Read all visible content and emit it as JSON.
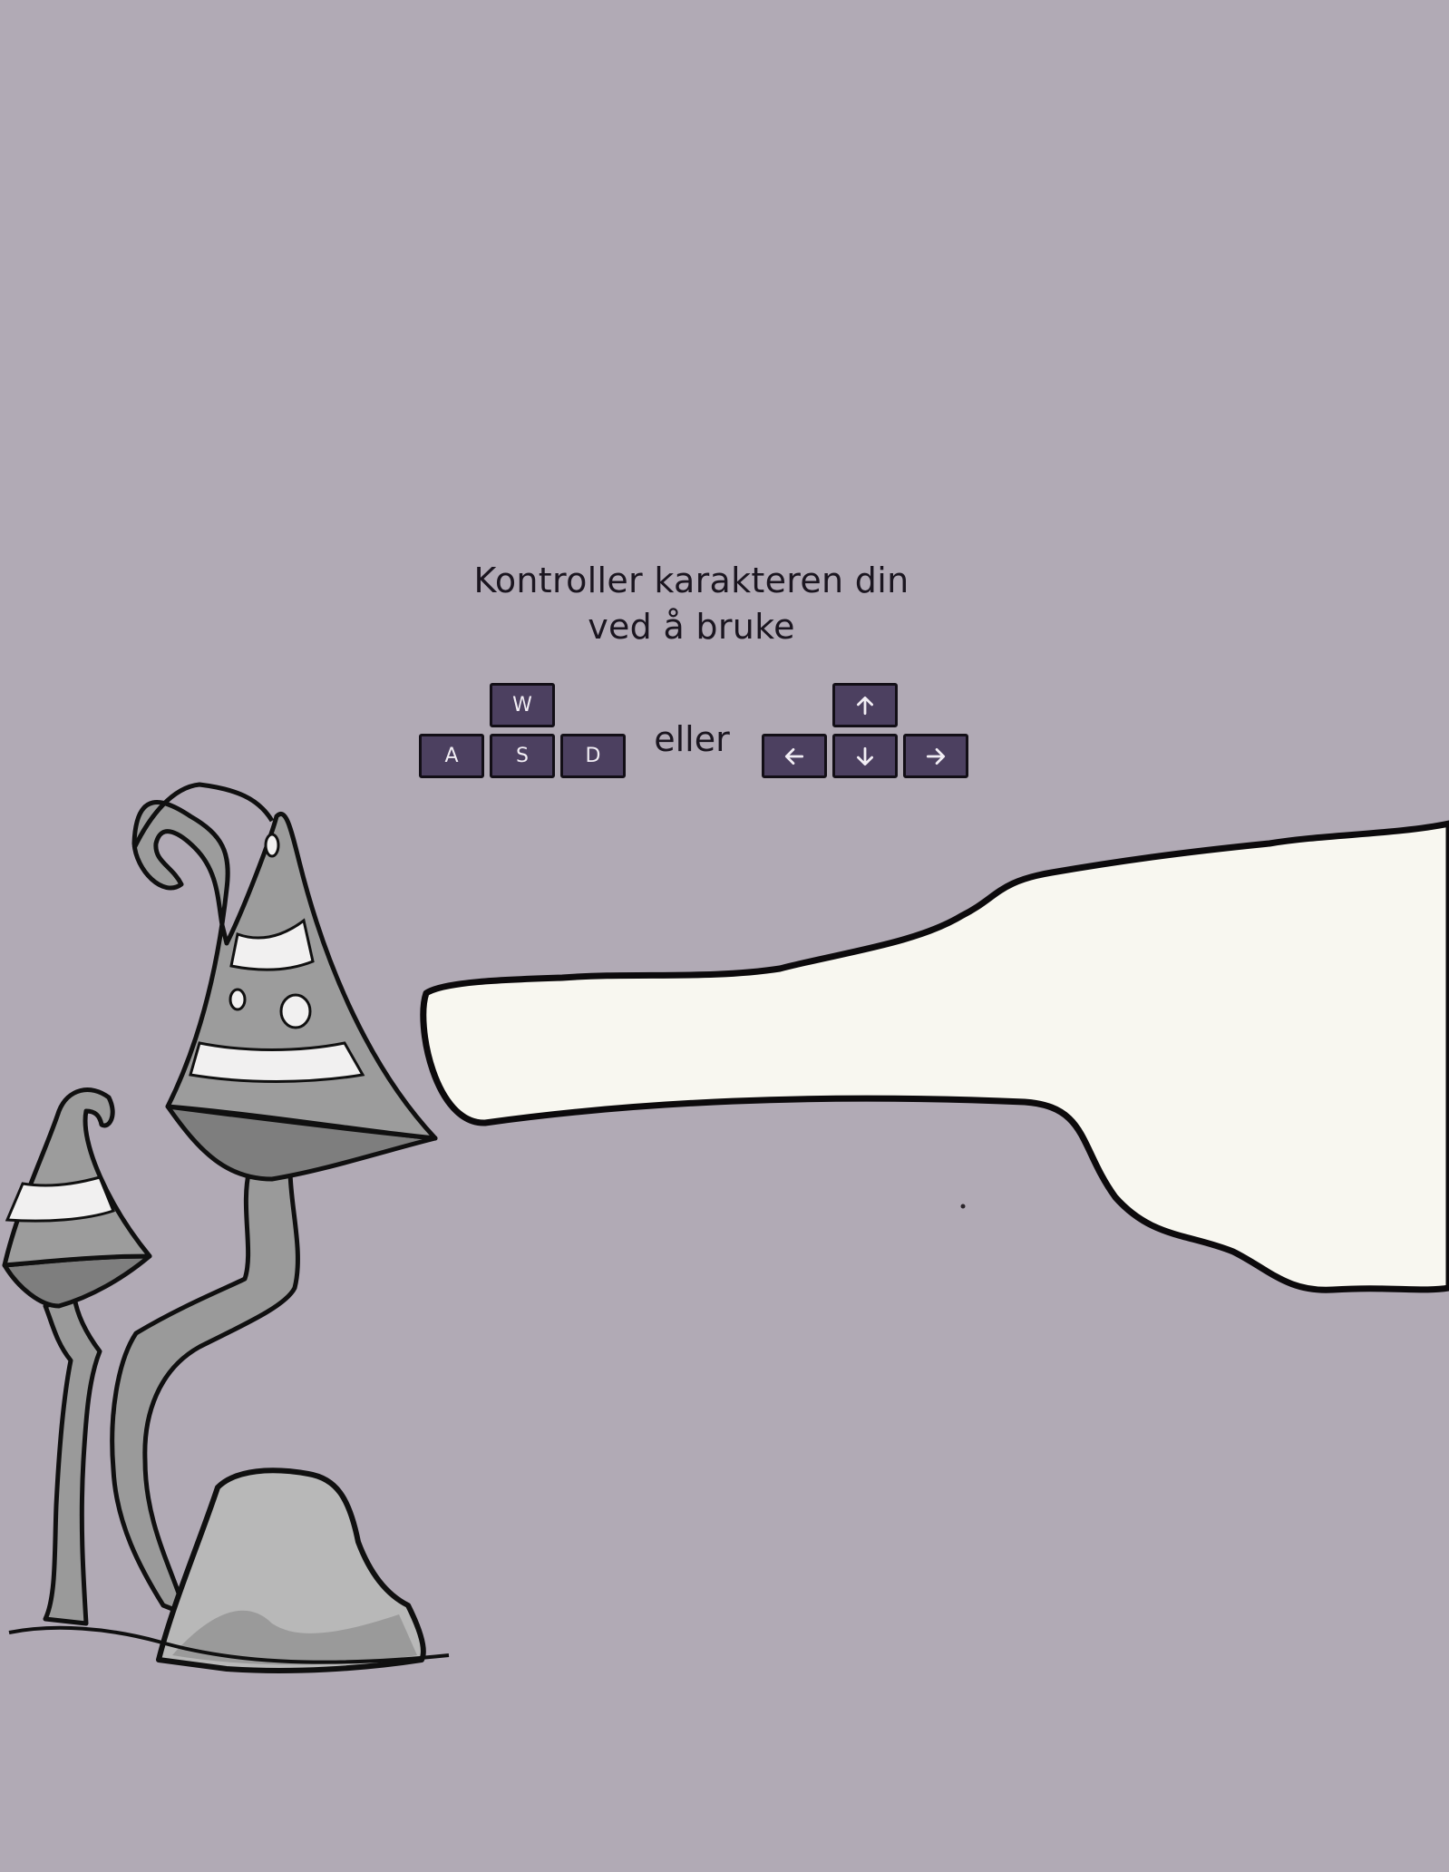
{
  "colors": {
    "background": "#b1aab5",
    "key_fill": "#4c4060",
    "key_border": "#120e16",
    "key_text": "#f2eef5",
    "text": "#1b1620",
    "path": "#f8f7f0",
    "mushroom_gray": "#8f8f8f",
    "rock_gray": "#b8b8b8"
  },
  "instructions": {
    "line1": "Kontroller karakteren din",
    "line2": "ved å bruke"
  },
  "keys": {
    "w": "W",
    "a": "A",
    "s": "S",
    "d": "D",
    "up_icon": "arrow-up-icon",
    "left_icon": "arrow-left-icon",
    "down_icon": "arrow-down-icon",
    "right_icon": "arrow-right-icon"
  },
  "separator": "eller"
}
